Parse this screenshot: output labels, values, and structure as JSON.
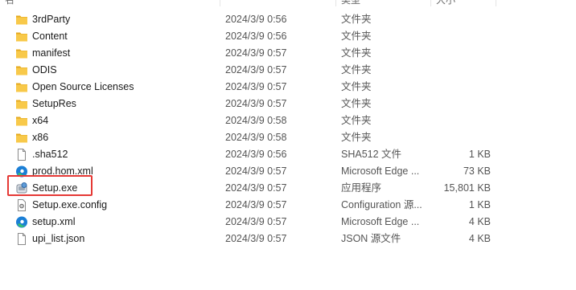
{
  "header": {
    "name_fragment": "名",
    "type_fragment": "类型",
    "size_fragment": "大小"
  },
  "files": [
    {
      "name": "3rdParty",
      "date": "2024/3/9 0:56",
      "type": "文件夹",
      "size": "",
      "icon": "folder-icon"
    },
    {
      "name": "Content",
      "date": "2024/3/9 0:56",
      "type": "文件夹",
      "size": "",
      "icon": "folder-icon"
    },
    {
      "name": "manifest",
      "date": "2024/3/9 0:57",
      "type": "文件夹",
      "size": "",
      "icon": "folder-icon"
    },
    {
      "name": "ODIS",
      "date": "2024/3/9 0:57",
      "type": "文件夹",
      "size": "",
      "icon": "folder-icon"
    },
    {
      "name": "Open Source Licenses",
      "date": "2024/3/9 0:57",
      "type": "文件夹",
      "size": "",
      "icon": "folder-icon"
    },
    {
      "name": "SetupRes",
      "date": "2024/3/9 0:57",
      "type": "文件夹",
      "size": "",
      "icon": "folder-icon"
    },
    {
      "name": "x64",
      "date": "2024/3/9 0:58",
      "type": "文件夹",
      "size": "",
      "icon": "folder-icon"
    },
    {
      "name": "x86",
      "date": "2024/3/9 0:58",
      "type": "文件夹",
      "size": "",
      "icon": "folder-icon"
    },
    {
      "name": ".sha512",
      "date": "2024/3/9 0:56",
      "type": "SHA512 文件",
      "size": "1 KB",
      "icon": "file-icon"
    },
    {
      "name": "prod.hom.xml",
      "date": "2024/3/9 0:57",
      "type": "Microsoft Edge ...",
      "size": "73 KB",
      "icon": "edge-icon"
    },
    {
      "name": "Setup.exe",
      "date": "2024/3/9 0:57",
      "type": "应用程序",
      "size": "15,801 KB",
      "icon": "setup-exe-icon"
    },
    {
      "name": "Setup.exe.config",
      "date": "2024/3/9 0:57",
      "type": "Configuration 源...",
      "size": "1 KB",
      "icon": "config-file-icon"
    },
    {
      "name": "setup.xml",
      "date": "2024/3/9 0:57",
      "type": "Microsoft Edge ...",
      "size": "4 KB",
      "icon": "edge-icon"
    },
    {
      "name": "upi_list.json",
      "date": "2024/3/9 0:57",
      "type": "JSON 源文件",
      "size": "4 KB",
      "icon": "file-icon"
    }
  ],
  "colors": {
    "folder": "#f8c94a",
    "folder_dark": "#e5a91f",
    "highlight": "#e53935",
    "edge_blue": "#1b7fd6",
    "edge_green": "#36c26f"
  }
}
